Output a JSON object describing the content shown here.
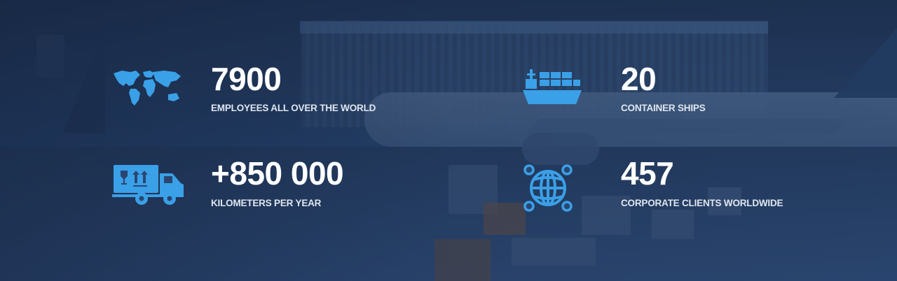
{
  "colors": {
    "icon": "#3aa0e8",
    "number": "#ffffff",
    "label": "#dfe6ef",
    "overlay": "#1f3559"
  },
  "stats": [
    {
      "icon": "world-map-icon",
      "number": "7900",
      "label": "EMPLOYEES ALL OVER THE WORLD"
    },
    {
      "icon": "container-ship-icon",
      "number": "20",
      "label": "CONTAINER SHIPS"
    },
    {
      "icon": "delivery-truck-icon",
      "number": "+850 000",
      "label": "KILOMETERS PER YEAR"
    },
    {
      "icon": "globe-network-icon",
      "number": "457",
      "label": "CORPORATE CLIENTS WORLDWIDE"
    }
  ]
}
